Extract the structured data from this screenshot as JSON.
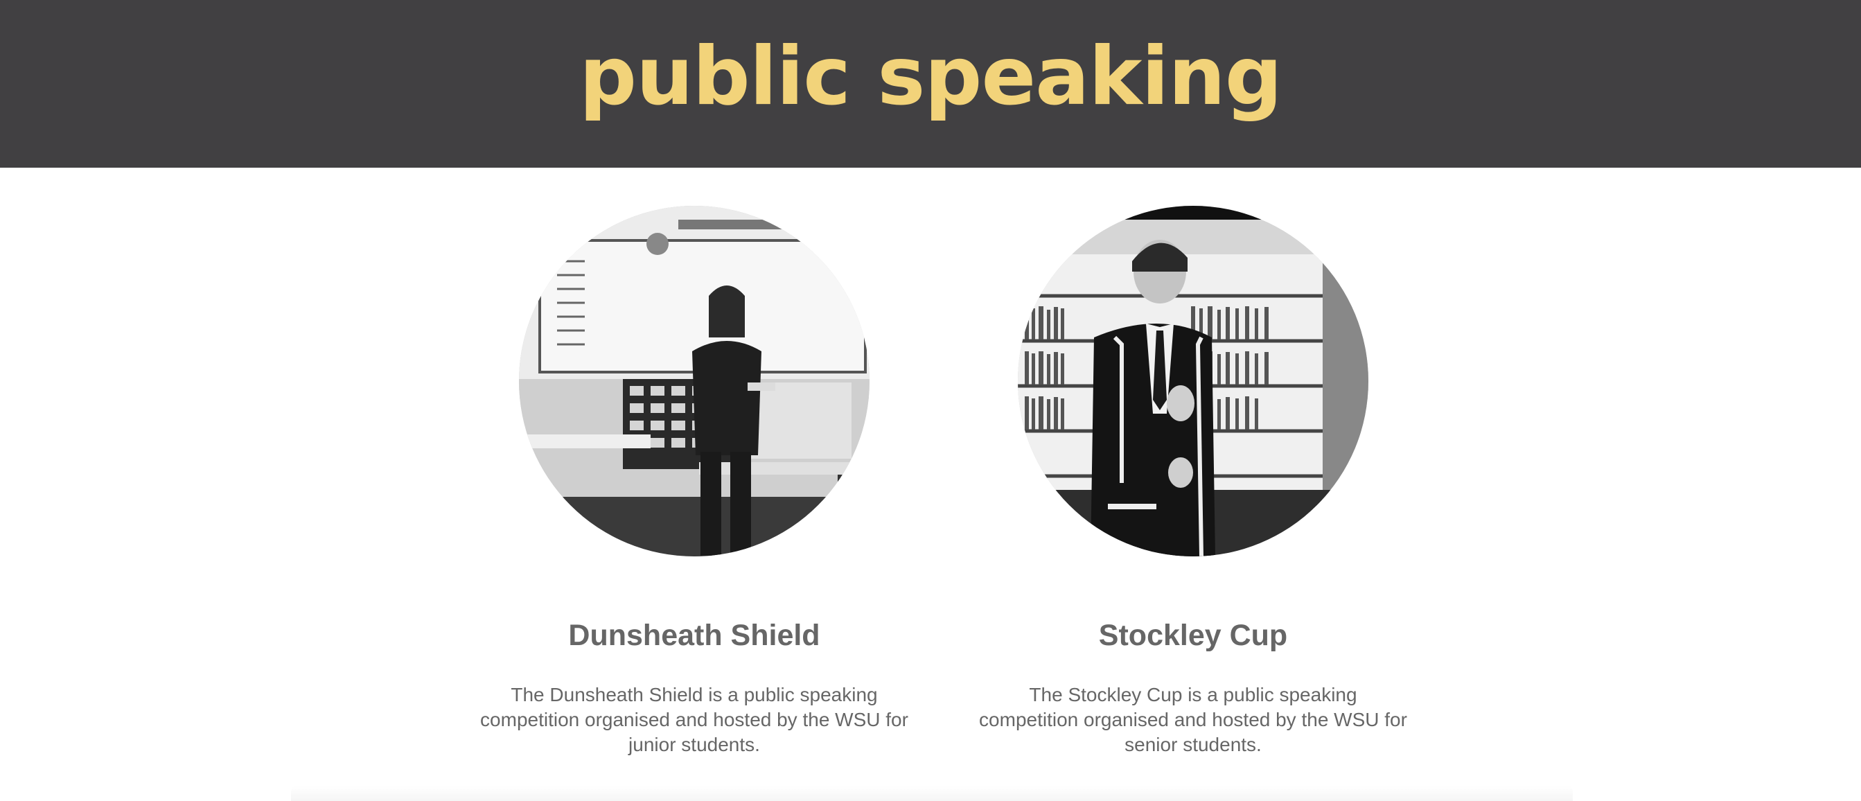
{
  "header": {
    "title": "public speaking",
    "background_color": "#414042",
    "title_color": "#f2d37a"
  },
  "cards": [
    {
      "title": "Dunsheath Shield",
      "description": "The Dunsheath Shield is a public speaking competition organised and hosted by the WSU for junior students.",
      "image": "speaker-classroom-photo"
    },
    {
      "title": "Stockley Cup",
      "description": "The Stockley Cup is a public speaking competition organised and hosted by the WSU for senior students.",
      "image": "speaker-library-photo"
    }
  ]
}
